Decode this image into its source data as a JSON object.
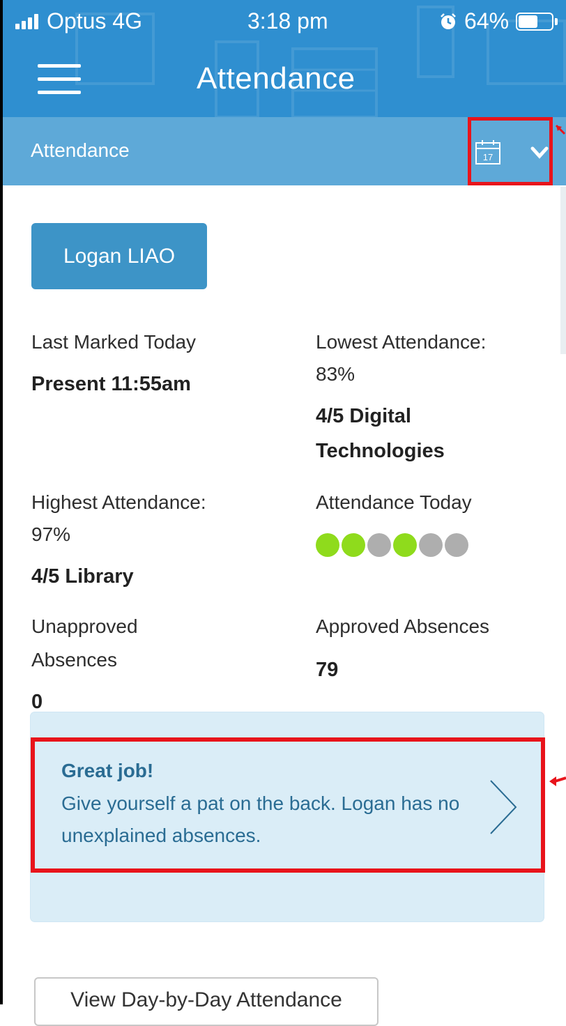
{
  "status_bar": {
    "carrier": "Optus 4G",
    "time": "3:18 pm",
    "battery_percent": "64%",
    "battery_level": 0.64
  },
  "app_bar": {
    "title": "Attendance"
  },
  "sub_header": {
    "label": "Attendance",
    "calendar_day": "17"
  },
  "student": {
    "name": "Logan LIAO"
  },
  "stats": {
    "last_marked": {
      "label": "Last Marked Today",
      "value": "Present 11:55am"
    },
    "lowest": {
      "label_line1": "Lowest Attendance:",
      "label_line2": "83%",
      "value_line1": "4/5 Digital",
      "value_line2": "Technologies"
    },
    "highest": {
      "label_line1": "Highest Attendance:",
      "label_line2": "97%",
      "value": "4/5 Library"
    },
    "today": {
      "label": "Attendance Today",
      "periods": [
        "present",
        "present",
        "unmarked",
        "present",
        "unmarked",
        "unmarked"
      ]
    },
    "unapproved": {
      "label_line1": "Unapproved",
      "label_line2": "Absences",
      "value": "0"
    },
    "approved": {
      "label": "Approved Absences",
      "value": "79"
    }
  },
  "alert": {
    "title": "Great job!",
    "body": "Give yourself a pat on the back. Logan has no unexplained absences."
  },
  "day_view_button": {
    "label": "View Day-by-Day Attendance"
  },
  "colors": {
    "app_bar": "#2f8fd0",
    "sub_header": "#5ea9d8",
    "student_button": "#3d94c7",
    "present": "#8fdb1c",
    "unmarked": "#aeaeae",
    "alert_bg": "#daedf7",
    "alert_text": "#2a6c93",
    "highlight": "#e8141b"
  },
  "icons": {
    "menu": "hamburger-icon",
    "calendar": "calendar-icon",
    "dropdown": "chevron-down-icon",
    "alert_action": "chevron-right-icon",
    "alarm": "alarm-icon"
  }
}
